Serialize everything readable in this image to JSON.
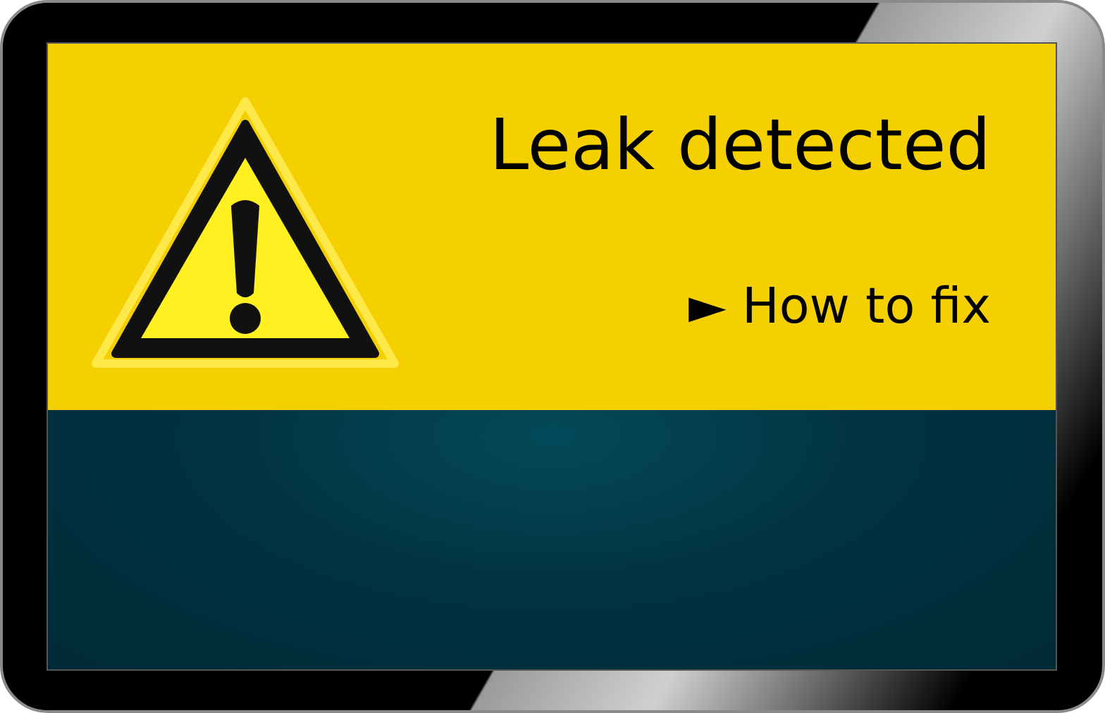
{
  "alert": {
    "title": "Leak detected",
    "link": {
      "arrow": "►",
      "label": "How to fix"
    }
  }
}
